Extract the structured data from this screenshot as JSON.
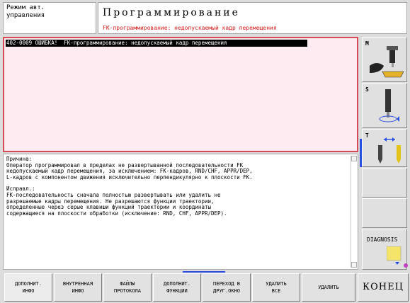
{
  "header": {
    "mode_line1": "Режим авт.",
    "mode_line2": "управления",
    "title": "Программирование",
    "subtitle": "FK-программирование: недопускаемый кадр перемещения"
  },
  "error": {
    "line": "402-0009 ОШИБКА!  FK-программирование: недопускаемый кадр перемещения"
  },
  "info": {
    "cause_lines": [
      "Причина:",
      "Оператор программировал в пределах не развертыванной последовательности FK",
      "недопускаемый кадр перемещения, за исключением: FK-кадров, RND/CHF, APPR/DEP,",
      "L-кадров с компонентом движения исключительно перпендикулярно к плоскости FK."
    ],
    "fix_lines": [
      "Исправл.:",
      "FK-последовательность сначала полностью развертывать или удалить не",
      "разрешаемые кадры перемещения. Не разрешаются функции траектории,",
      "определенные через серые клавиши функций траектории и координаты",
      "содержащиеся на плоскости обработки (исключение: RND, CHF, APPR/DEP)."
    ]
  },
  "side": {
    "m_label": "M",
    "s_label": "S",
    "t_label": "T",
    "diagnosis_label": "DIAGNOSIS"
  },
  "softkeys": [
    "ДОПОЛНИТ.\nИНФО",
    "ВНУТРЕННАЯ\nИНФО",
    "ФАЙЛЫ\nПРОТОКОЛА",
    "ДОПОЛНИТ.\nФУНКЦИИ",
    "ПЕРЕХОД В\nДРУГ.ОКНО",
    "УДАЛИТЬ\nВСЕ",
    "УДАЛИТЬ"
  ],
  "konec": "КОНЕЦ",
  "colors": {
    "error_border": "#d64a58",
    "error_bg": "#fdebf1",
    "subtitle": "#d81818",
    "accent": "#2a50e0"
  }
}
